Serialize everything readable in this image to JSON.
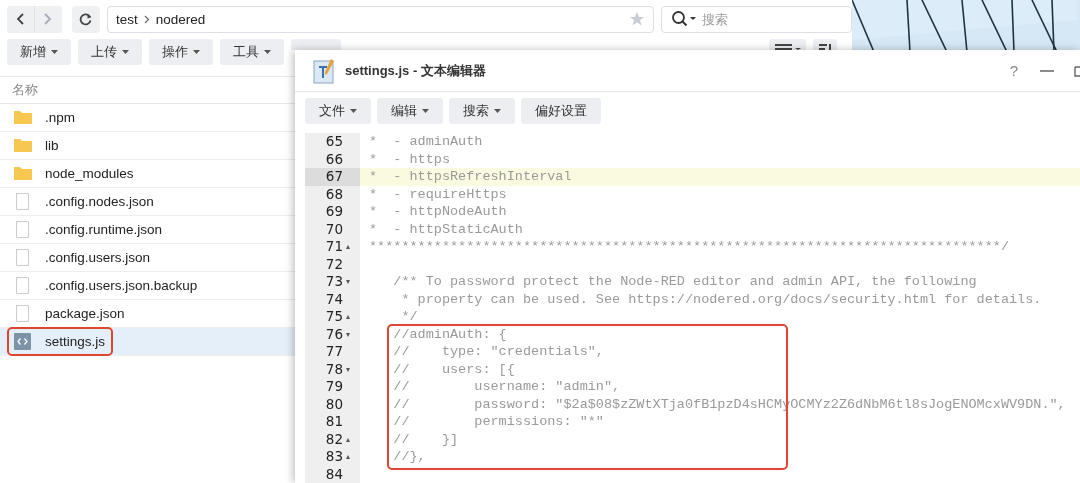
{
  "file_manager": {
    "nav": [
      {
        "kind": "back",
        "disabled": false
      },
      {
        "kind": "forward",
        "disabled": true
      }
    ],
    "path": [
      "test",
      "nodered"
    ],
    "search": {
      "placeholder": "搜索"
    },
    "toolbar": [
      {
        "label": "新增",
        "dropdown": true
      },
      {
        "label": "上传",
        "dropdown": true
      },
      {
        "label": "操作",
        "dropdown": true
      },
      {
        "label": "工具",
        "dropdown": true
      },
      {
        "dropdown": false
      }
    ],
    "column_header": "名称",
    "files": [
      {
        "name": ".npm",
        "kind": "folder",
        "selected": false,
        "marked": false
      },
      {
        "name": "lib",
        "kind": "folder",
        "selected": false,
        "marked": false
      },
      {
        "name": "node_modules",
        "kind": "folder",
        "selected": false,
        "marked": false
      },
      {
        "name": ".config.nodes.json",
        "kind": "file",
        "selected": false,
        "marked": false
      },
      {
        "name": ".config.runtime.json",
        "kind": "file",
        "selected": false,
        "marked": false
      },
      {
        "name": ".config.users.json",
        "kind": "file",
        "selected": false,
        "marked": false
      },
      {
        "name": ".config.users.json.backup",
        "kind": "file",
        "selected": false,
        "marked": false
      },
      {
        "name": "package.json",
        "kind": "file",
        "selected": false,
        "marked": false
      },
      {
        "name": "settings.js",
        "kind": "code",
        "selected": true,
        "marked": true
      }
    ]
  },
  "editor": {
    "title": "settings.js - 文本编辑器",
    "help": "?",
    "menu": [
      {
        "label": "文件",
        "dropdown": true
      },
      {
        "label": "编辑",
        "dropdown": true
      },
      {
        "label": "搜索",
        "dropdown": true
      },
      {
        "label": "偏好设置",
        "dropdown": false
      }
    ],
    "blocks": [
      {
        "marked": false,
        "lines": [
          {
            "number": "65",
            "text": "*  - adminAuth",
            "current": false
          },
          {
            "number": "66",
            "text": "*  - https",
            "current": false
          },
          {
            "number": "67",
            "text": "*  - httpsRefreshInterval",
            "current": true
          },
          {
            "number": "68",
            "text": "*  - requireHttps",
            "current": false
          },
          {
            "number": "69",
            "text": "*  - httpNodeAuth",
            "current": false
          },
          {
            "number": "70",
            "text": "*  - httpStaticAuth",
            "current": false
          },
          {
            "number": "71",
            "text": "******************************************************************************/",
            "current": false,
            "fold": "▴"
          },
          {
            "number": "72",
            "current": false
          },
          {
            "number": "73",
            "text": "   /** To password protect the Node-RED editor and admin API, the following",
            "current": false,
            "fold": "▾"
          },
          {
            "number": "74",
            "text": "    * property can be used. See https://nodered.org/docs/security.html for details.",
            "current": false
          },
          {
            "number": "75",
            "text": "    */",
            "current": false,
            "fold": "▴"
          }
        ]
      },
      {
        "marked": true,
        "lines": [
          {
            "number": "76",
            "text": "   //adminAuth: {",
            "current": false,
            "fold": "▾"
          },
          {
            "number": "77",
            "text": "   //    type: \"credentials\",",
            "current": false
          },
          {
            "number": "78",
            "text": "   //    users: [{",
            "current": false,
            "fold": "▾"
          },
          {
            "number": "79",
            "text": "   //        username: \"admin\",",
            "current": false
          },
          {
            "number": "80",
            "text": "   //        password: \"$2a$08$zZWtXTja0fB1pzD4sHCMyOCMYz2Z6dNbM6tl8sJogENOMcxWV9DN.\",",
            "current": false
          },
          {
            "number": "81",
            "text": "   //        permissions: \"*\"",
            "current": false
          },
          {
            "number": "82",
            "text": "   //    }]",
            "current": false,
            "fold": "▴"
          },
          {
            "number": "83",
            "text": "   //},",
            "current": false,
            "fold": "▴"
          }
        ]
      },
      {
        "marked": false,
        "lines": [
          {
            "number": "84",
            "current": false
          }
        ]
      }
    ]
  }
}
